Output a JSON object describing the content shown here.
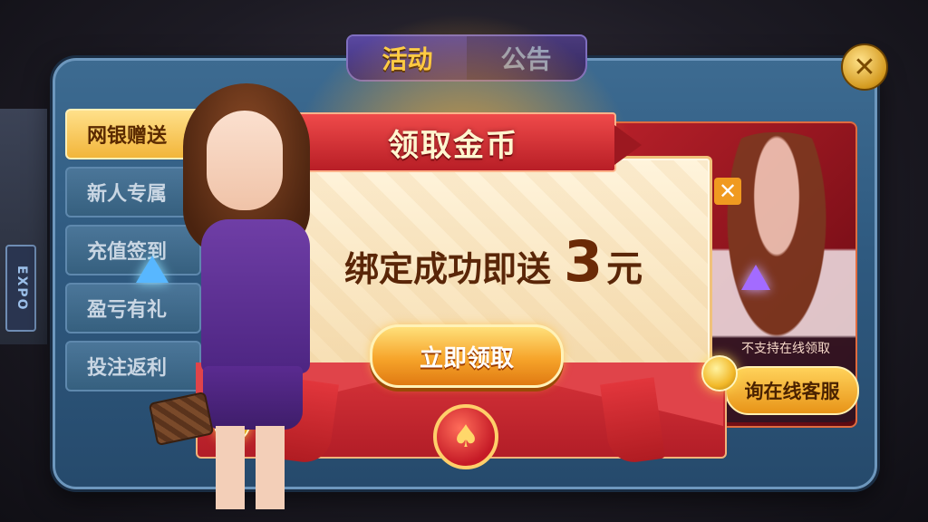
{
  "tabs": [
    {
      "label": "活动",
      "active": true
    },
    {
      "label": "公告",
      "active": false
    }
  ],
  "close_label": "✕",
  "background_sign": "EXPO",
  "side_menu": [
    {
      "label": "网银赠送",
      "active": true
    },
    {
      "label": "新人专属",
      "active": false
    },
    {
      "label": "充值签到",
      "active": false
    },
    {
      "label": "盈亏有礼",
      "active": false
    },
    {
      "label": "投注返利",
      "active": false
    }
  ],
  "background_card": {
    "note": "不支持在线领取",
    "service_button": "询在线客服",
    "close_label": "✕"
  },
  "popup": {
    "title": "领取金币",
    "reward_prefix": "绑定成功即送",
    "reward_amount": "3",
    "reward_unit": "元",
    "claim_button": "立即领取",
    "seal_icon": "♠"
  },
  "colors": {
    "panel": "#2f5a80",
    "accent_gold": "#f2b53a",
    "popup_red": "#d8343a",
    "tab_active": "#ffd24a"
  }
}
